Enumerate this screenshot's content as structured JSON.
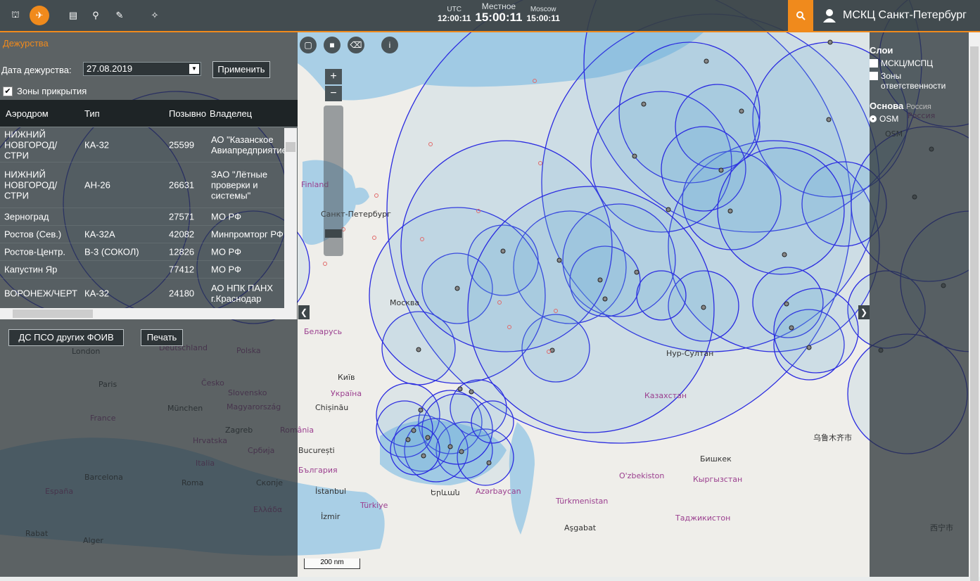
{
  "topbar": {
    "nav": [
      {
        "name": "airfield-icon",
        "glyph": "⛫"
      },
      {
        "name": "aircraft-icon",
        "glyph": "✈"
      },
      {
        "name": "list-icon",
        "glyph": "▤"
      },
      {
        "name": "map-pin-icon",
        "glyph": "⚲"
      },
      {
        "name": "edit-icon",
        "glyph": "✎"
      },
      {
        "name": "satellite-icon",
        "glyph": "✧"
      }
    ],
    "clock": {
      "utc_label": "UTC",
      "utc_time": "12:00:11",
      "local_label": "Местное",
      "local_time": "15:00:11",
      "moscow_label": "Moscow",
      "moscow_time": "15:00:11"
    },
    "user": "МСКЦ Санкт-Петербург",
    "accent": "#f08a1c"
  },
  "duty": {
    "title": "Дежурства",
    "date_label": "Дата дежурства:",
    "date_value": "27.08.2019",
    "apply": "Применить",
    "zones_label": "Зоны прикрытия",
    "zones_checked": "✔",
    "columns": [
      "Аэродром",
      "Тип",
      "Позывно",
      "Владелец"
    ],
    "rows": [
      {
        "aerodrome": "НИЖНИЙ НОВГОРОД/СТРИ",
        "type": "КА-32",
        "callsign": "25599",
        "owner": "АО \"Казанское Авиапредприятие\""
      },
      {
        "aerodrome": "НИЖНИЙ НОВГОРОД/СТРИ",
        "type": "АН-26",
        "callsign": "26631",
        "owner": "ЗАО \"Лётные проверки и системы\""
      },
      {
        "aerodrome": "Зерноград",
        "type": "",
        "callsign": "27571",
        "owner": "МО РФ"
      },
      {
        "aerodrome": "Ростов (Сев.)",
        "type": "КА-32А",
        "callsign": "42082",
        "owner": "Минпромторг РФ"
      },
      {
        "aerodrome": "Ростов-Центр.",
        "type": "В-3 (СОКОЛ)",
        "callsign": "12826",
        "owner": "МО РФ"
      },
      {
        "aerodrome": "Капустин Яр",
        "type": "",
        "callsign": "77412",
        "owner": "МО РФ"
      },
      {
        "aerodrome": "ВОРОНЕЖ/ЧЕРТ",
        "type": "КА-32",
        "callsign": "24180",
        "owner": "АО НПК ПАНХ г.Краснодар"
      }
    ],
    "other_btn": "ДС ПСО других ФОИВ",
    "print_btn": "Печать"
  },
  "map": {
    "scale": "200 nm",
    "labels": [
      {
        "text": "Москва",
        "kind": "city"
      },
      {
        "text": "Санкт-Петербург",
        "kind": "city"
      },
      {
        "text": "Беларусь",
        "kind": "country"
      },
      {
        "text": "Київ",
        "kind": "city"
      },
      {
        "text": "Україна",
        "kind": "country"
      },
      {
        "text": "Chișinău",
        "kind": "city"
      },
      {
        "text": "Нур-Султан",
        "kind": "city"
      },
      {
        "text": "Казахстан",
        "kind": "country"
      },
      {
        "text": "O'zbekiston",
        "kind": "country"
      },
      {
        "text": "Кыргызстан",
        "kind": "country"
      },
      {
        "text": "Бишкек",
        "kind": "city"
      },
      {
        "text": "Türkmenistan",
        "kind": "country"
      },
      {
        "text": "Таджикистон",
        "kind": "country"
      },
      {
        "text": "Aşgabat",
        "kind": "city"
      },
      {
        "text": "İstanbul",
        "kind": "city"
      },
      {
        "text": "Türkiye",
        "kind": "country"
      },
      {
        "text": "İzmir",
        "kind": "city"
      },
      {
        "text": "Azərbaycan",
        "kind": "country"
      },
      {
        "text": "Երևան",
        "kind": "city"
      },
      {
        "text": "Paris",
        "kind": "city"
      },
      {
        "text": "France",
        "kind": "country"
      },
      {
        "text": "München",
        "kind": "city"
      },
      {
        "text": "Magyarország",
        "kind": "country"
      },
      {
        "text": "Zagreb",
        "kind": "city"
      },
      {
        "text": "România",
        "kind": "country"
      },
      {
        "text": "București",
        "kind": "city"
      },
      {
        "text": "България",
        "kind": "country"
      },
      {
        "text": "Italia",
        "kind": "country"
      },
      {
        "text": "Roma",
        "kind": "city"
      },
      {
        "text": "Barcelona",
        "kind": "city"
      },
      {
        "text": "España",
        "kind": "country"
      },
      {
        "text": "London",
        "kind": "city"
      },
      {
        "text": "Polska",
        "kind": "country"
      },
      {
        "text": "Česko",
        "kind": "country"
      },
      {
        "text": "Slovensko",
        "kind": "country"
      },
      {
        "text": "Hrvatska",
        "kind": "country"
      },
      {
        "text": "Србија",
        "kind": "country"
      },
      {
        "text": "Скопје",
        "kind": "city"
      },
      {
        "text": "Ελλάδα",
        "kind": "country"
      },
      {
        "text": "Alger",
        "kind": "city"
      },
      {
        "text": "Rabat",
        "kind": "city"
      },
      {
        "text": "Deutschland",
        "kind": "country"
      },
      {
        "text": "Finland",
        "kind": "country"
      },
      {
        "text": "乌鲁木齐市",
        "kind": "city"
      },
      {
        "text": "西宁市",
        "kind": "city"
      },
      {
        "text": "Россия",
        "kind": "country"
      },
      {
        "text": "OSM",
        "kind": "city"
      }
    ]
  },
  "layers": {
    "title": "Слои",
    "items": [
      "МСКЦ/МСПЦ",
      "Зоны ответственности"
    ],
    "base_title": "Основа",
    "base_items": [
      "OSM"
    ],
    "russia_hint": "Россия"
  }
}
